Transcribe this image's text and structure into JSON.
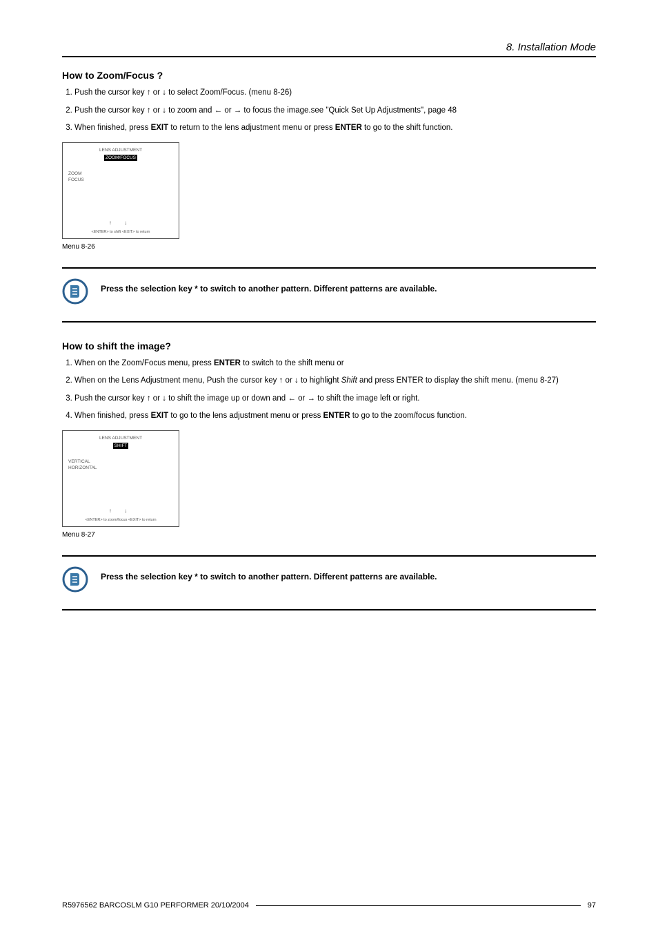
{
  "header": {
    "chapter": "8. Installation Mode"
  },
  "section1": {
    "title": "How to Zoom/Focus ?",
    "step1_pre": "Push the cursor key ↑ or ↓ to select Zoom/Focus. (",
    "step1_ref": "menu 8-26",
    "step1_post": ")",
    "step2": "Push the cursor key ↑ or ↓ to zoom and ← or → to focus the image.see \"Quick Set Up Adjustments\", page 48",
    "step3_pre": "When finished, press ",
    "step3_exit": "EXIT",
    "step3_mid": " to return to the lens adjustment menu or press ",
    "step3_enter": "ENTER",
    "step3_post": " to go to the shift function."
  },
  "menu1": {
    "title_line1": "LENS ADJUSTMENT",
    "hl": "ZOOM/FOCUS",
    "line_zoom": "ZOOM",
    "line_focus": "FOCUS",
    "arrows": "↑    ↓",
    "hint": "<ENTER> to shift   <EXIT> to return",
    "caption": "Menu 8-26"
  },
  "note1": {
    "text": "Press the selection key * to switch to another pattern. Different patterns are available."
  },
  "section2": {
    "title": "How to shift the image?",
    "step1_pre": "When on the Zoom/Focus menu, press ",
    "step1_enter": "ENTER",
    "step1_post": " to switch to the shift menu or",
    "step2_pre": "When on the Lens Adjustment menu, Push the cursor key ↑ or ↓ to highlight ",
    "step2_shift": "Shift",
    "step2_mid": " and press ENTER to display the shift menu. (",
    "step2_ref": "menu 8-27",
    "step2_post": ")",
    "step3": "Push the cursor key ↑ or ↓ to shift the image up or down and ← or → to shift the image left or right.",
    "step4_pre": "When finished, press ",
    "step4_exit": "EXIT",
    "step4_mid": " to go to the lens adjustment menu or press ",
    "step4_enter": "ENTER",
    "step4_post": " to go to the zoom/focus function."
  },
  "menu2": {
    "title_line1": "LENS ADJUSTMENT",
    "hl": "SHIFT",
    "line_v": "VERTICAL",
    "line_h": "HORIZONTAL",
    "arrows": "↑    ↓",
    "hint": "<ENTER> to zoom/focus   <EXIT> to return",
    "caption": "Menu 8-27"
  },
  "note2": {
    "text": "Press the selection key * to switch to another pattern. Different patterns are available."
  },
  "footer": {
    "left": "R5976562  BARCOSLM G10 PERFORMER  20/10/2004",
    "page": "97"
  }
}
